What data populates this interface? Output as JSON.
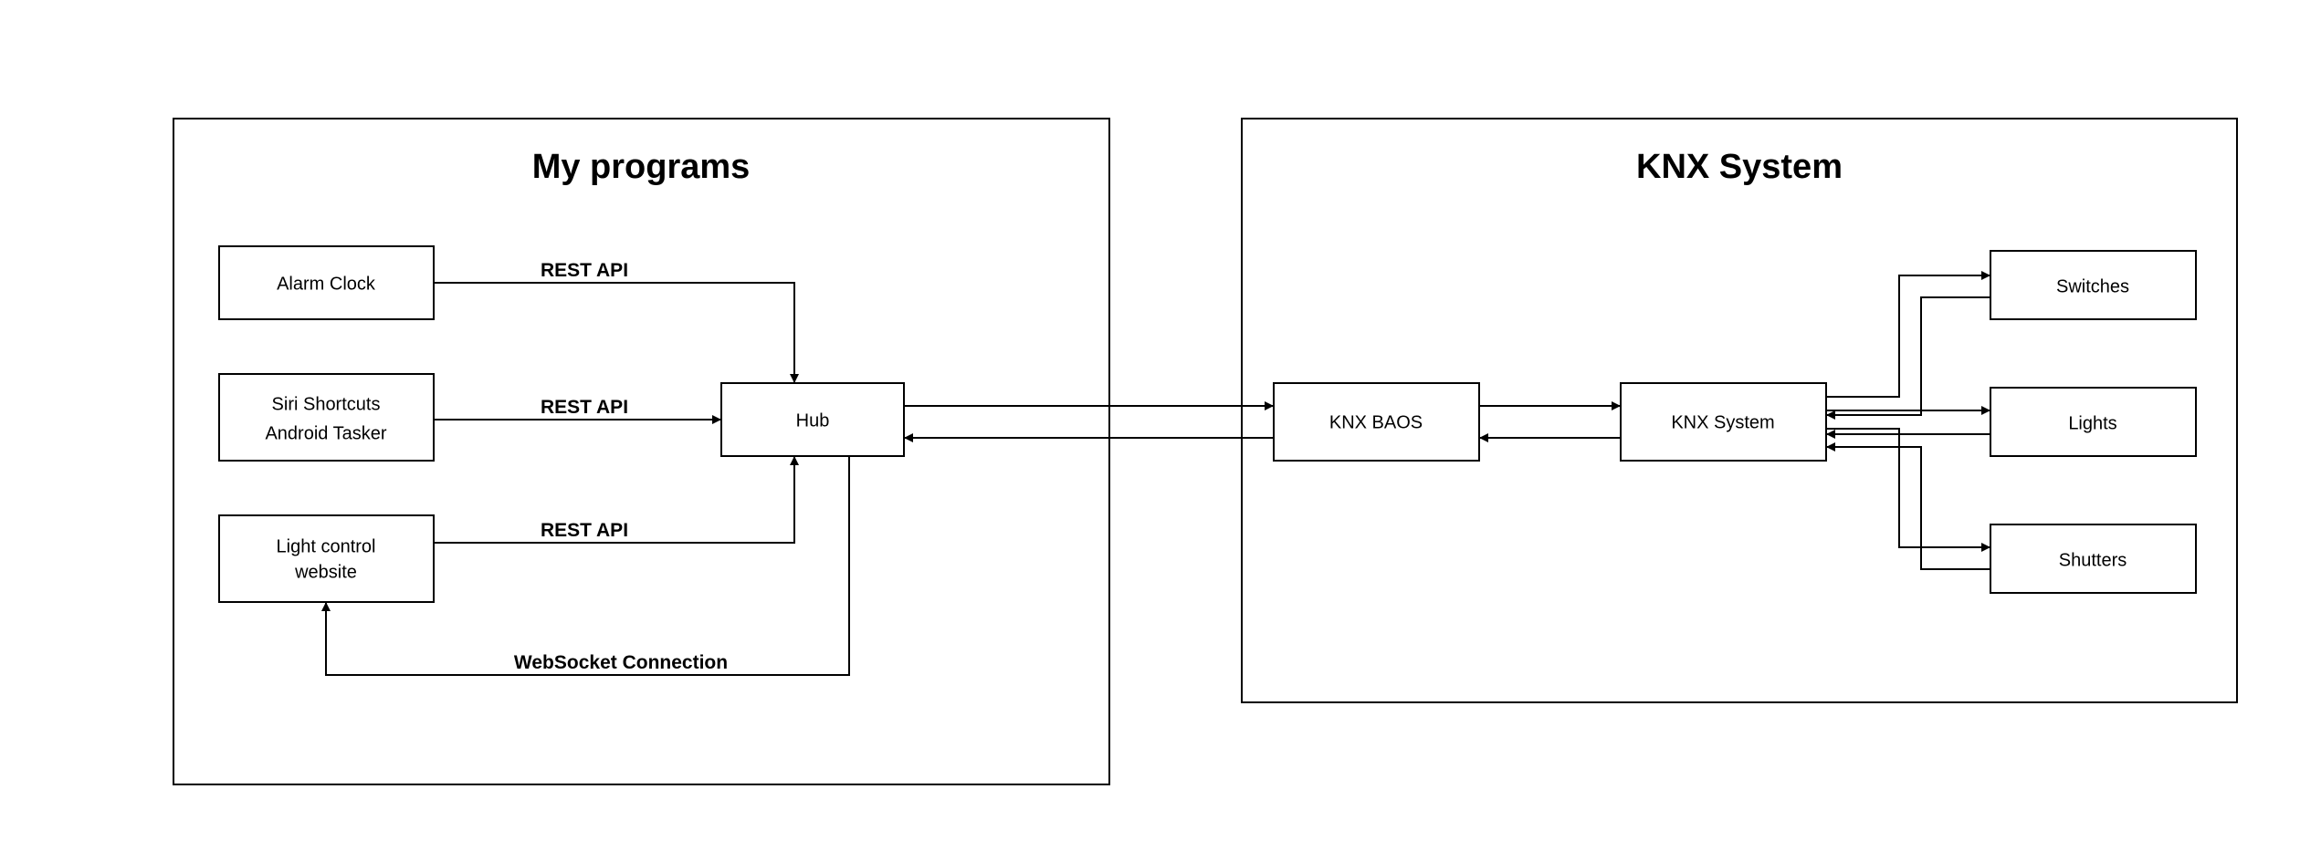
{
  "groups": {
    "my_programs": {
      "title": "My programs"
    },
    "knx_system": {
      "title": "KNX System"
    }
  },
  "nodes": {
    "alarm_clock": {
      "label": "Alarm Clock"
    },
    "siri_shortcuts": {
      "label_line1": "Siri Shortcuts",
      "label_line2": "Android Tasker"
    },
    "light_control": {
      "label_line1": "Light control",
      "label_line2": "website"
    },
    "hub": {
      "label": "Hub"
    },
    "knx_baos": {
      "label": "KNX BAOS"
    },
    "knx_system_node": {
      "label": "KNX System"
    },
    "switches": {
      "label": "Switches"
    },
    "lights": {
      "label": "Lights"
    },
    "shutters": {
      "label": "Shutters"
    }
  },
  "edge_labels": {
    "rest_api_1": "REST API",
    "rest_api_2": "REST API",
    "rest_api_3": "REST API",
    "websocket": "WebSocket Connection"
  }
}
